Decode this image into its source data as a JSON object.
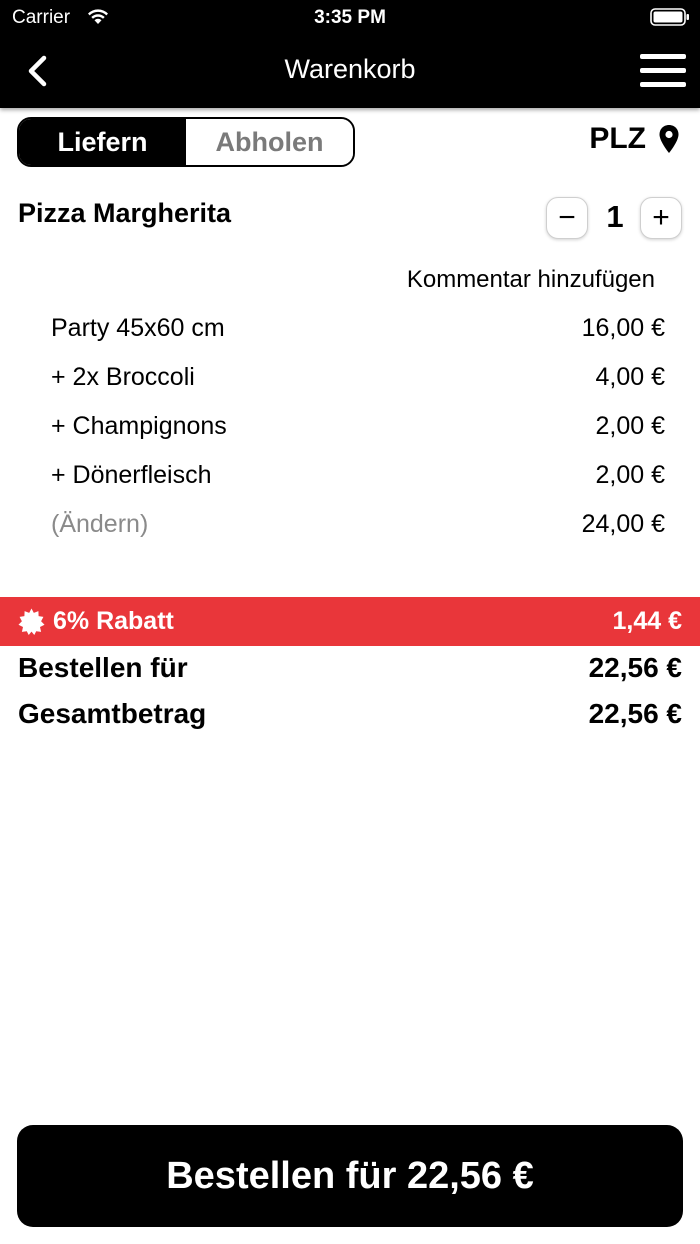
{
  "status_bar": {
    "carrier": "Carrier",
    "time": "3:35 PM"
  },
  "nav": {
    "title": "Warenkorb"
  },
  "delivery_toggle": {
    "options": [
      "Liefern",
      "Abholen"
    ],
    "selected": "Liefern"
  },
  "plz": {
    "label": "PLZ"
  },
  "product": {
    "name": "Pizza Margherita",
    "quantity": "1",
    "minus_label": "−",
    "plus_label": "+",
    "comment_link": "Kommentar hinzufügen",
    "lines": [
      {
        "name": "Party 45x60 cm",
        "price": "16,00 €"
      },
      {
        "name": "+ 2x Broccoli",
        "price": "4,00 €"
      },
      {
        "name": "+ Champignons",
        "price": "2,00 €"
      },
      {
        "name": "+ Dönerfleisch",
        "price": "2,00 €"
      },
      {
        "name": "(Ändern)",
        "price": "24,00 €"
      }
    ]
  },
  "discount": {
    "label": "6% Rabatt",
    "amount": "1,44 €",
    "color": "#e9363a"
  },
  "totals": [
    {
      "label": "Bestellen für",
      "value": "22,56 €"
    },
    {
      "label": "Gesamtbetrag",
      "value": "22,56 €"
    }
  ],
  "order_button": {
    "label": "Bestellen für 22,56 €"
  },
  "icons": {
    "back": "chevron-left-icon",
    "menu": "hamburger-menu-icon",
    "location": "map-pin-icon",
    "discount": "badge-icon",
    "wifi": "wifi-icon",
    "battery": "battery-icon"
  }
}
